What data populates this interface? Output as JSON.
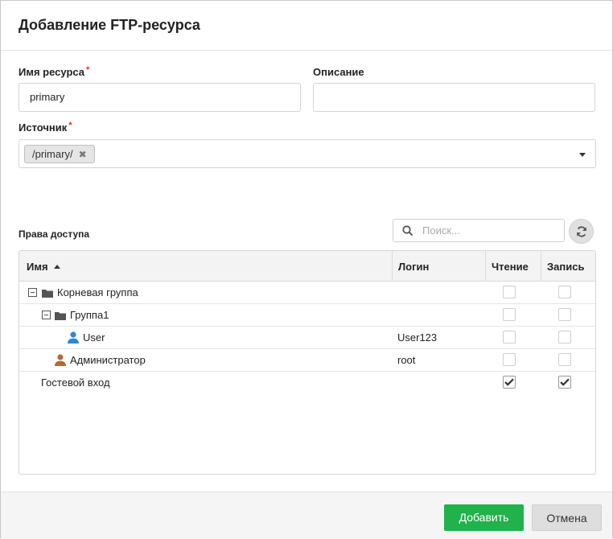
{
  "dialog": {
    "title": "Добавление FTP-ресурса"
  },
  "form": {
    "name_label": "Имя ресурса",
    "required_mark": "*",
    "name_value": "primary",
    "description_label": "Описание",
    "description_value": "",
    "source_label": "Источник",
    "source_tags": [
      "/primary/"
    ]
  },
  "access": {
    "label": "Права доступа",
    "search_placeholder": "Поиск...",
    "columns": {
      "name": "Имя",
      "login": "Логин",
      "read": "Чтение",
      "write": "Запись"
    },
    "rows": [
      {
        "name": "Корневая группа",
        "login": "",
        "read": false,
        "write": false,
        "type": "group",
        "level": 0,
        "expanded": true
      },
      {
        "name": "Группа1",
        "login": "",
        "read": false,
        "write": false,
        "type": "group",
        "level": 1,
        "expanded": true
      },
      {
        "name": "User",
        "login": "User123",
        "read": false,
        "write": false,
        "type": "user",
        "level": 2
      },
      {
        "name": "Администратор",
        "login": "root",
        "read": false,
        "write": false,
        "type": "admin",
        "level": 1
      },
      {
        "name": "Гостевой вход",
        "login": "",
        "read": true,
        "write": true,
        "type": "guest",
        "level": 0
      }
    ]
  },
  "footer": {
    "add_label": "Добавить",
    "cancel_label": "Отмена"
  },
  "colors": {
    "accent": "#21b24b",
    "required": "#e0302a",
    "user_icon": "#2f87d0",
    "admin_icon": "#b26a3c",
    "folder_icon": "#555555"
  },
  "icons": [
    "search-icon",
    "refresh-icon",
    "folder-icon",
    "user-icon",
    "tag-remove-icon",
    "dropdown-arrow-icon",
    "sort-asc-icon",
    "checkmark-icon"
  ]
}
